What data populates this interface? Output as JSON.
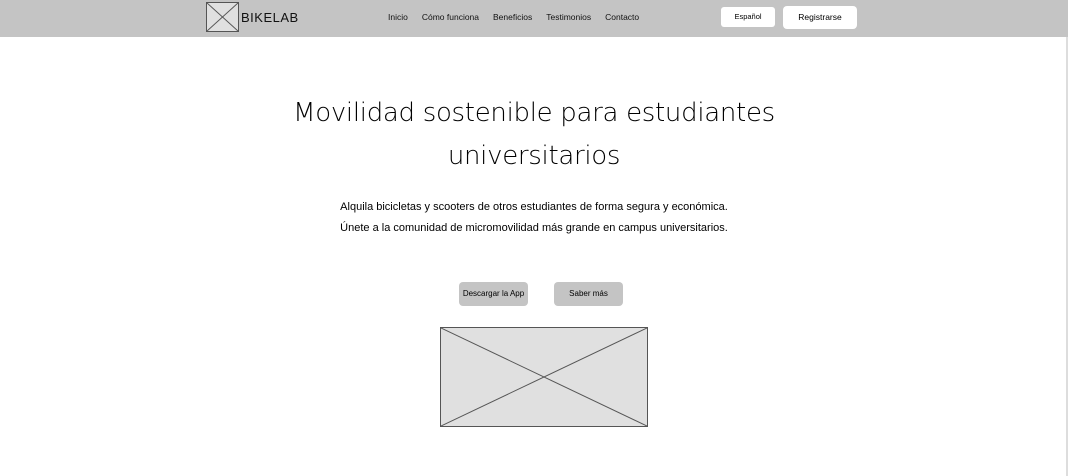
{
  "header": {
    "brand": "BIKELAB",
    "nav": [
      "Inicio",
      "Cómo funciona",
      "Beneficios",
      "Testimonios",
      "Contacto"
    ],
    "language": "Español",
    "register": "Registrarse"
  },
  "hero": {
    "title_line1": "Movilidad sostenible para estudiantes",
    "title_line2": "universitarios",
    "description": "Alquila bicicletas y scooters de otros estudiantes de forma segura y económica. Únete a la comunidad de micromovilidad más grande en campus universitarios.",
    "primary_button": "Descargar la App",
    "secondary_button": "Saber más"
  }
}
